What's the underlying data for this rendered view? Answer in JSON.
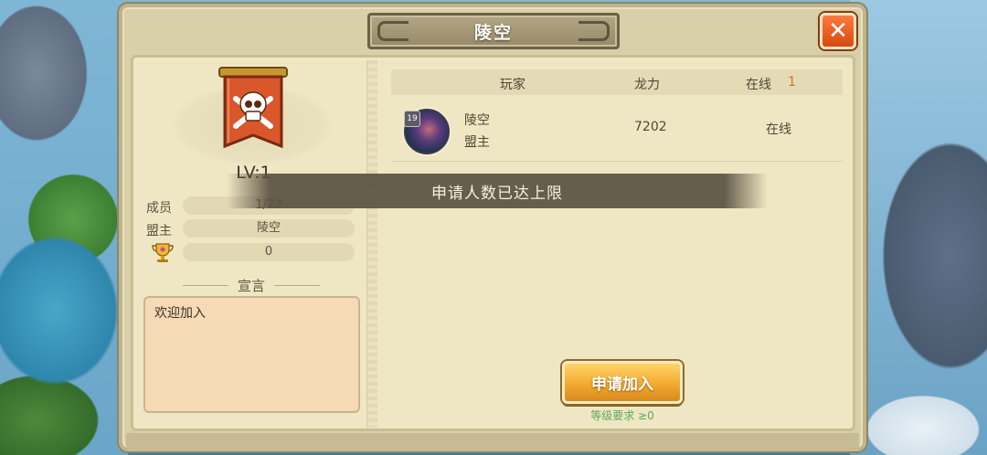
{
  "window": {
    "title": "陵空"
  },
  "close_icon": "close-icon",
  "guild": {
    "level_text": "LV:1",
    "rows": [
      {
        "label": "成员",
        "value": "1/22"
      },
      {
        "label": "盟主",
        "value": "陵空"
      },
      {
        "label": "",
        "value": "0",
        "icon": "trophy-icon"
      }
    ],
    "declaration_title": "宣言",
    "declaration_text": "欢迎加入",
    "emblem": "skull-banner-icon",
    "emblem_color": "#d9572a"
  },
  "members_table": {
    "headers": {
      "player": "玩家",
      "power": "龙力",
      "online": "在线",
      "online_count": "1"
    },
    "rows": [
      {
        "level": "19",
        "name": "陵空",
        "role": "盟主",
        "power": "7202",
        "status": "在线"
      }
    ]
  },
  "toast": "申请人数已达上限",
  "apply": {
    "label": "申请加入",
    "requirement": "等级要求 ≥0"
  },
  "colors": {
    "accent": "#f2a92f",
    "close": "#d64a12",
    "online_count": "#d96a2a",
    "requirement": "#5fa85a"
  }
}
